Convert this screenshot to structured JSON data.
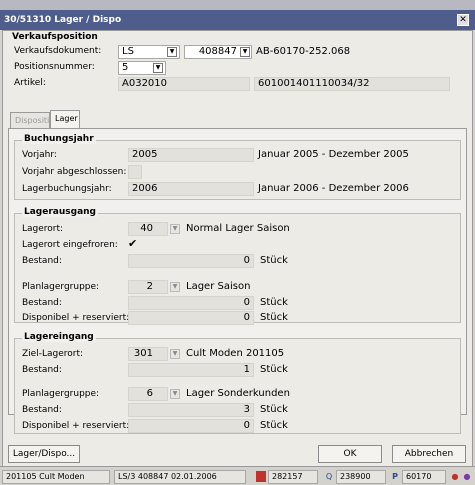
{
  "window": {
    "title": "30/51310 Lager / Dispo",
    "close_glyph": "✕"
  },
  "verkaufsposition": {
    "header": "Verkaufsposition",
    "verkaufsdokument_label": "Verkaufsdokument:",
    "verkaufsdokument_type": "LS",
    "verkaufsdokument_number": "408847",
    "verkaufsdokument_ref": "AB-60170-252.068",
    "positionsnummer_label": "Positionsnummer:",
    "positionsnummer_value": "5",
    "artikel_label": "Artikel:",
    "artikel_code": "A032010",
    "artikel_ean": "601001401110034/32"
  },
  "tabs": [
    {
      "label": "Disposition"
    },
    {
      "label": "Lager"
    }
  ],
  "buchungsjahr": {
    "header": "Buchungsjahr",
    "vorjahr_label": "Vorjahr:",
    "vorjahr_value": "2005",
    "vorjahr_range": "Januar 2005 - Dezember 2005",
    "abgeschlossen_label": "Vorjahr abgeschlossen:",
    "lagerbuchungsjahr_label": "Lagerbuchungsjahr:",
    "lagerbuchungsjahr_value": "2006",
    "lagerbuchungsjahr_range": "Januar 2006 - Dezember 2006"
  },
  "lagerausgang": {
    "header": "Lagerausgang",
    "lagerort_label": "Lagerort:",
    "lagerort_value": "40",
    "lagerort_name": "Normal Lager Saison",
    "eingefroren_label": "Lagerort eingefroren:",
    "eingefroren_check": "✔",
    "bestand_label": "Bestand:",
    "bestand_value": "0",
    "bestand_unit": "Stück",
    "planlagergruppe_label": "Planlagergruppe:",
    "planlagergruppe_value": "2",
    "planlagergruppe_name": "Lager Saison",
    "bestand2_label": "Bestand:",
    "bestand2_value": "0",
    "bestand2_unit": "Stück",
    "disponibel_label": "Disponibel + reserviert:",
    "disponibel_value": "0",
    "disponibel_unit": "Stück"
  },
  "lagereingang": {
    "header": "Lagereingang",
    "ziellagerort_label": "Ziel-Lagerort:",
    "ziellagerort_value": "301",
    "ziellagerort_name": "Cult Moden 201105",
    "bestand_label": "Bestand:",
    "bestand_value": "1",
    "bestand_unit": "Stück",
    "planlagergruppe_label": "Planlagergruppe:",
    "planlagergruppe_value": "6",
    "planlagergruppe_name": "Lager Sonderkunden",
    "bestand2_label": "Bestand:",
    "bestand2_value": "3",
    "bestand2_unit": "Stück",
    "disponibel_label": "Disponibel + reserviert:",
    "disponibel_value": "0",
    "disponibel_unit": "Stück"
  },
  "buttons": {
    "lager_dispo": "Lager/Dispo...",
    "ok": "OK",
    "abbrechen": "Abbrechen"
  },
  "statusbar": {
    "item1": "201105 Cult Moden",
    "item2": "LS/3 408847 02.01.2006",
    "item3": "282157",
    "item4": "238900",
    "item5_letter": "P",
    "item5": "60170"
  }
}
